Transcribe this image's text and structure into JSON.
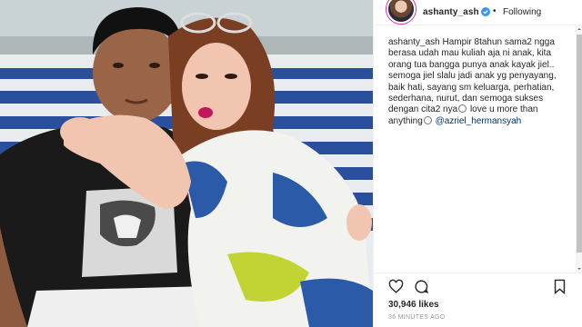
{
  "header": {
    "username": "ashanty_ash",
    "separator": "•",
    "follow_label": "Following"
  },
  "caption": {
    "username": "ashanty_ash",
    "text": "Hampir 8tahun sama2 ngga berasa udah mau kuliah aja ni anak, kita orang tua bangga punya anak kayak jiel.. semoga jiel slalu jadi anak yg penyayang, baik hati, sayang sm keluarga, perhatian, sederhana, nurut, dan semoga sukses dengan cita2 nya",
    "text_end": " love u more than anything",
    "mention": "@azriel_hermansyah"
  },
  "stats": {
    "likes": "30,946 likes",
    "timestamp": "36 MINUTES AGO"
  },
  "icons": {
    "verified": "verified-badge-icon",
    "like": "heart-icon",
    "comment": "comment-icon",
    "save": "bookmark-icon"
  },
  "colors": {
    "verified": "#3897f0",
    "mention": "#003569",
    "stripe_blue": "#2a4f9c"
  }
}
